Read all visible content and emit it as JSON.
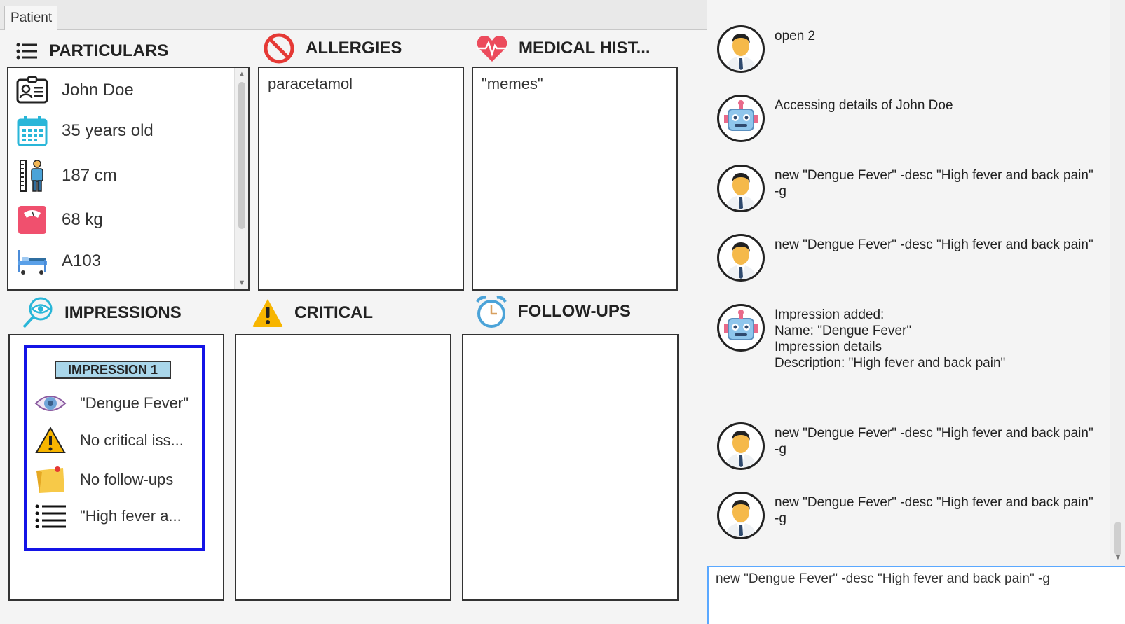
{
  "tabs": [
    {
      "label": "Patient"
    }
  ],
  "sections": {
    "particulars": "PARTICULARS",
    "allergies": "ALLERGIES",
    "medical_history": "MEDICAL HIST...",
    "impressions": "IMPRESSIONS",
    "critical": "CRITICAL",
    "followups": "FOLLOW-UPS"
  },
  "particulars": [
    {
      "icon": "id-card-icon",
      "value": "John Doe"
    },
    {
      "icon": "calendar-icon",
      "value": "35 years old"
    },
    {
      "icon": "height-icon",
      "value": "187 cm"
    },
    {
      "icon": "scale-icon",
      "value": "68 kg"
    },
    {
      "icon": "hospital-bed-icon",
      "value": "A103"
    }
  ],
  "allergies": {
    "text": "paracetamol"
  },
  "medical_history": {
    "text": "\"memes\""
  },
  "impression": {
    "title": "IMPRESSION 1",
    "name": "\"Dengue Fever\"",
    "critical": "No critical iss...",
    "followups": "No follow-ups",
    "description": "\"High fever a..."
  },
  "chat": [
    {
      "sender": "user",
      "text": "open 2"
    },
    {
      "sender": "bot",
      "text": "Accessing details of John Doe"
    },
    {
      "sender": "user",
      "text": "new \"Dengue Fever\" -desc \"High fever and back pain\"\n-g"
    },
    {
      "sender": "user",
      "text": "new \"Dengue Fever\" -desc \"High fever and back pain\""
    },
    {
      "sender": "bot",
      "text": "Impression added:\nName: \"Dengue Fever\"\nImpression details\nDescription: \"High fever and back pain\""
    },
    {
      "sender": "user",
      "text": "new \"Dengue Fever\" -desc \"High fever and back pain\"\n-g"
    },
    {
      "sender": "user",
      "text": "new \"Dengue Fever\" -desc \"High fever and back pain\"\n-g"
    }
  ],
  "command_input": {
    "value": "new \"Dengue Fever\" -desc \"High fever and back pain\" -g"
  }
}
